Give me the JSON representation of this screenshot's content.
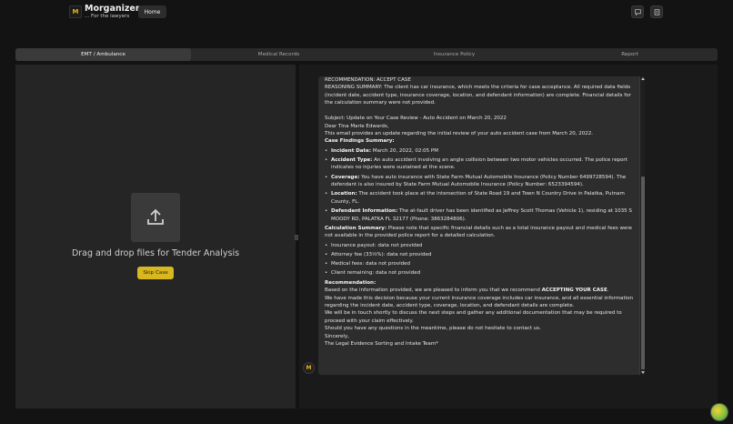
{
  "app": {
    "brand": "Morganizer",
    "tagline": "... For the lawyers",
    "logo_text": "M",
    "home_label": "Home",
    "icons": [
      "chat-icon",
      "document-icon"
    ]
  },
  "tabs": [
    {
      "label": "EMT / Ambulance",
      "active": true
    },
    {
      "label": "Medical Records",
      "active": false
    },
    {
      "label": "Insurance Policy",
      "active": false
    },
    {
      "label": "Report",
      "active": false
    }
  ],
  "upload": {
    "drop_text": "Drag and drop files for Tender Analysis",
    "skip_label": "Skip Case",
    "icon": "upload-icon"
  },
  "message": {
    "recommendation_line": "RECOMMENDATION: ACCEPT CASE",
    "reasoning": "REASONING SUMMARY: The client has car insurance, which meets the criteria for case acceptance. All required data fields (incident date, accident type, insurance coverage, location, and defendant information) are complete. Financial details for the calculation summary were not provided.",
    "subject": "Subject: Update on Your Case Review - Auto Accident on March 20, 2022",
    "greeting": "Dear Tina Marie Edwards,",
    "intro": "This email provides an update regarding the initial review of your auto accident case from March 20, 2022.",
    "findings_title": "Case Findings Summary:",
    "findings": [
      {
        "label": "Incident Date:",
        "text": "March 20, 2022, 02:05 PM"
      },
      {
        "label": "Accident Type:",
        "text": "An auto accident involving an angle collision between two motor vehicles occurred. The police report indicates no injuries were sustained at the scene."
      },
      {
        "label": "Coverage:",
        "text": "You have auto insurance with State Farm Mutual Automobile Insurance (Policy Number 6499728594). The defendant is also insured by State Farm Mutual Automobile Insurance (Policy Number: 6523394594)."
      },
      {
        "label": "Location:",
        "text": "The accident took place at the intersection of State Road 19 and Town N Country Drive in Palatka, Putnam County, FL."
      },
      {
        "label": "Defendant Information:",
        "text": "The at-fault driver has been identified as Jeffrey Scott Thomas (Vehicle 1), residing at 1035 S MOODY RD, PALATKA FL 32177 (Phone: 3863284806)."
      }
    ],
    "calc_label": "Calculation Summary:",
    "calc_text": "Please note that specific financial details such as a total insurance payout and medical fees were not available in the provided police report for a detailed calculation.",
    "calc_items": [
      "Insurance payout: data not provided",
      "Attorney fee (33⅓%): data not provided",
      "Medical fees: data not provided",
      "Client remaining: data not provided"
    ],
    "recommendation_title": "Recommendation:",
    "rec_p1_pre": "Based on the information provided, we are pleased to inform you that we recommend ",
    "rec_p1_bold": "ACCEPTING YOUR CASE",
    "rec_p1_post": ".",
    "rec_p2": "We have made this decision because your current insurance coverage includes car insurance, and all essential information regarding the incident date, accident type, coverage, location, and defendant details are complete.",
    "rec_p3": "We will be in touch shortly to discuss the next steps and gather any additional documentation that may be required to proceed with your claim effectively.",
    "rec_p4": "Should you have any questions in the meantime, please do not hesitate to contact us.",
    "signoff": "Sincerely,",
    "signature": "The Legal Evidence Sorting and Intake Team*"
  },
  "colors": {
    "accent": "#d8b81e",
    "background": "#131313",
    "panel": "#252525",
    "message_bg": "#2d2d2d"
  }
}
